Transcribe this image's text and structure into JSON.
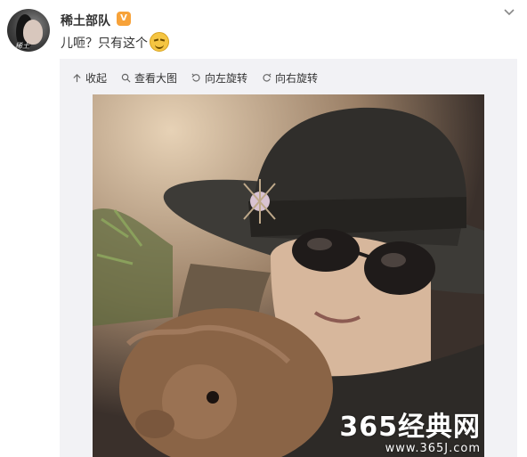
{
  "user": {
    "name": "稀土部队",
    "vip_badge": "V",
    "avatar_mark": "稀土"
  },
  "post": {
    "text": "儿咂？只有这个"
  },
  "toolbar": {
    "collapse_label": "收起",
    "view_large_label": "查看大图",
    "rotate_left_label": "向左旋转",
    "rotate_right_label": "向右旋转"
  },
  "photo": {
    "watermark_main": "365经典网",
    "watermark_url": "www.365J.com"
  },
  "icons": {
    "collapse": "arrow-up-icon",
    "view_large": "search-icon",
    "rotate_left": "rotate-left-icon",
    "rotate_right": "rotate-right-icon",
    "menu": "chevron-down-icon"
  }
}
